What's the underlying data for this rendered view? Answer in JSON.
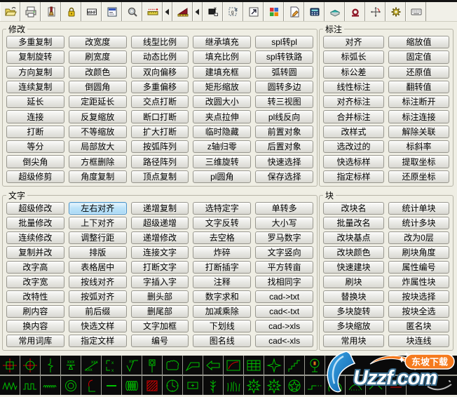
{
  "toolbar": {
    "icons": [
      "open-folder",
      "printer",
      "format-brush",
      "lock",
      "whf-block",
      "options-document",
      "magnifier",
      "ruler",
      "flyout-left",
      "slope-ramp",
      "flyout-left-2",
      "screen-capture",
      "group-selection",
      "export-link",
      "color-grid",
      "edit-note",
      "calculator",
      "layer-book",
      "magnet",
      "move-crosshair",
      "gear",
      "keyboard"
    ]
  },
  "groups": [
    {
      "id": "modify",
      "title": "修改",
      "columns": 5,
      "highlight_index": -1,
      "buttons": [
        "多重复制",
        "改宽度",
        "线型比例",
        "继承填充",
        "spl转pl",
        "复制旋转",
        "刷宽度",
        "动态比例",
        "填充比例",
        "spl转铁路",
        "方向复制",
        "改颜色",
        "双向偏移",
        "建填充框",
        "弧转圆",
        "连续复制",
        "倒圆角",
        "多重偏移",
        "矩形缩放",
        "圆转多边",
        "延长",
        "定距延长",
        "交点打断",
        "改圆大小",
        "转三视图",
        "连接",
        "反复缩放",
        "断口打断",
        "夹点拉伸",
        "pl线反向",
        "打断",
        "不等缩放",
        "扩大打断",
        "临时隐藏",
        "前置对象",
        "等分",
        "局部放大",
        "按弧阵列",
        "z轴归零",
        "后置对象",
        "倒尖角",
        "方框删除",
        "路径阵列",
        "三维旋转",
        "快速选择",
        "超级修剪",
        "角度复制",
        "顶点复制",
        "pl圆角",
        "保存选择"
      ]
    },
    {
      "id": "dimension",
      "title": "标注",
      "columns": 2,
      "highlight_index": -1,
      "buttons": [
        "对齐",
        "缩放值",
        "标弧长",
        "固定值",
        "标公差",
        "还原值",
        "线性标注",
        "翻转值",
        "对齐标注",
        "标注断开",
        "合并标注",
        "标注连接",
        "改样式",
        "解除关联",
        "选改过的",
        "标斜率",
        "快选标样",
        "提取坐标",
        "指定标样",
        "还原坐标"
      ]
    },
    {
      "id": "text",
      "title": "文字",
      "columns": 5,
      "highlight_index": 1,
      "buttons": [
        "超级修改",
        "左右对齐",
        "递增复制",
        "选特定字",
        "单转多",
        "批量修改",
        "上下对齐",
        "超级递增",
        "文字反转",
        "大小写",
        "连续修改",
        "调整行距",
        "递增修改",
        "去空格",
        "罗马数字",
        "复制并改",
        "排版",
        "连接文字",
        "炸碎",
        "文字竖向",
        "改字高",
        "表格居中",
        "打断文字",
        "打断插字",
        "平方转亩",
        "改字宽",
        "按线对齐",
        "字插入字",
        "注释",
        "找相同字",
        "改特性",
        "按弧对齐",
        "删头部",
        "数字求和",
        "cad->txt",
        "刷内容",
        "前后缀",
        "删尾部",
        "加减乘除",
        "cad<-txt",
        "换内容",
        "快选文样",
        "文字加框",
        "下划线",
        "cad->xls",
        "常用词库",
        "指定文样",
        "编号",
        "图名线",
        "cad<-xls"
      ]
    },
    {
      "id": "block",
      "title": "块",
      "columns": 2,
      "highlight_index": -1,
      "buttons": [
        "改块名",
        "统计单块",
        "批量改名",
        "统计多块",
        "改块基点",
        "改为0层",
        "改块颜色",
        "刷块角度",
        "快速建块",
        "属性编号",
        "刷块",
        "炸属性块",
        "替换块",
        "按块选择",
        "多块旋转",
        "按块全选",
        "多块缩放",
        "匿名块",
        "常用块",
        "块连线"
      ]
    }
  ],
  "icon_strip": {
    "row1": [
      "target-square",
      "target-circle",
      "section-break",
      "datum-xxx",
      "slope-xxx",
      "corner-marks",
      "roughness-xx",
      "weld-post",
      "revision-cloud",
      "leader-bubble",
      "arrow-left",
      "red-curve",
      "table-grid",
      "star-four",
      "stairs",
      "pole-circle"
    ],
    "row2": [
      "zigzag-wave",
      "square-wave",
      "small-wave",
      "concentric-rings",
      "red-hook",
      "dash-line",
      "coil-spring",
      "hatch-square",
      "clock",
      "rect-plus",
      "branch-tree",
      "grass",
      "gear-star",
      "gear-star-2",
      "circle-star",
      "step-dots",
      "arc-circle",
      "dome-dots",
      "chevron-roof",
      "parallel-lines"
    ]
  },
  "logo": {
    "wordmark": "Uzzf.com",
    "badge": "东坡下载"
  },
  "colors": {
    "highlight_bg": "#bfe4f9",
    "highlight_border": "#4a93c8",
    "strip_green": "#00c300",
    "strip_red": "#d40000",
    "logo_blue": "#1e7fd0",
    "logo_orange": "#f57a1d"
  }
}
